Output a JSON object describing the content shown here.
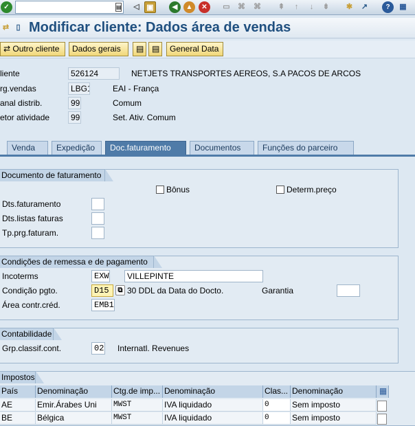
{
  "app": {
    "title": "Modificar cliente: Dados área de vendas"
  },
  "command_field": {
    "value": ""
  },
  "appbar": {
    "other_customer": "Outro cliente",
    "general_data": "Dados gerais",
    "general_data_en": "General Data"
  },
  "header": {
    "cliente_label": "liente",
    "cliente_value": "526124",
    "cliente_name": "NETJETS TRANSPORTES AEREOS, S.A PACOS DE ARCOS",
    "org_label": "rg.vendas",
    "org_value": "LBG1",
    "org_name": "EAI - França",
    "canal_label": "anal distrib.",
    "canal_value": "99",
    "canal_name": "Comum",
    "setor_label": "etor atividade",
    "setor_value": "99",
    "setor_name": "Set. Ativ. Comum"
  },
  "tabs": [
    "Venda",
    "Expedição",
    "Doc.faturamento",
    "Documentos",
    "Funções do parceiro"
  ],
  "doc_fat": {
    "title": "Documento de faturamento",
    "bonus": "Bônus",
    "determ": "Determ.preço",
    "dts_fat": "Dts.faturamento",
    "dts_listas": "Dts.listas faturas",
    "tp_prg": "Tp.prg.faturam."
  },
  "condicoes": {
    "title": "Condições de remessa e de pagamento",
    "incoterms_label": "Incoterms",
    "incoterms_value": "EXW",
    "incoterms_place": "VILLEPINTE",
    "cond_label": "Condição pgto.",
    "cond_value": "D15",
    "cond_desc": "30 DDL da Data do Docto.",
    "garantia_label": "Garantia",
    "area_label": "Área contr.créd.",
    "area_value": "EMB1"
  },
  "contabilidade": {
    "title": "Contabilidade",
    "grp_label": "Grp.classif.cont.",
    "grp_value": "02",
    "grp_desc": "Internatl. Revenues"
  },
  "impostos": {
    "title": "Impostos",
    "columns": [
      "País",
      "Denominação",
      "Ctg.de imp...",
      "Denominação",
      "Clas...",
      "Denominação"
    ],
    "rows": [
      [
        "AE",
        "Emir.Árabes Uni",
        "MWST",
        "IVA liquidado",
        "0",
        "Sem imposto"
      ],
      [
        "BE",
        "Bélgica",
        "MWST",
        "IVA liquidado",
        "0",
        "Sem imposto"
      ]
    ]
  }
}
